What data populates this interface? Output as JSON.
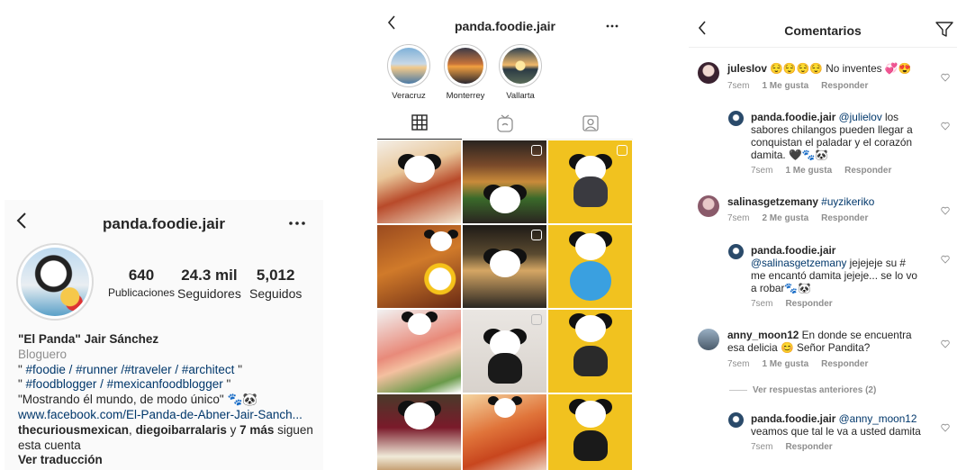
{
  "profile": {
    "back_icon": "chevron-left-icon",
    "username": "panda.foodie.jair",
    "more_icon": "more-horizontal-icon",
    "stats": [
      {
        "value": "640",
        "label": "Publicaciones"
      },
      {
        "value": "24.3 mil",
        "label": "Seguidores"
      },
      {
        "value": "5,012",
        "label": "Seguidos"
      }
    ],
    "bio": {
      "name": "\"El Panda\" Jair Sánchez",
      "category": "Bloguero",
      "line1_pre": "\" ",
      "line1_tags": "#foodie / #runner /#traveler / #architect",
      "line1_post": " \"",
      "line2_pre": "\" ",
      "line2_tags": "#foodblogger / #mexicanfoodblogger",
      "line2_post": " \"",
      "line3": "\"Mostrando él mundo, de modo único\" 🐾🐼",
      "link": "www.facebook.com/El-Panda-de-Abner-Jair-Sanch...",
      "followers_a": "thecuriousmexican",
      "followers_sep1": ", ",
      "followers_b": "diegoibarralaris",
      "followers_sep2": " y ",
      "followers_c": "7 más",
      "followers_tail": " siguen",
      "followers_tail2": "esta cuenta",
      "translate": "Ver traducción"
    }
  },
  "grid_view": {
    "username": "panda.foodie.jair",
    "highlights": [
      {
        "label": "Veracruz"
      },
      {
        "label": "Monterrey"
      },
      {
        "label": "Vallarta"
      }
    ],
    "tabs": [
      "grid-icon",
      "igtv-icon",
      "tagged-icon"
    ]
  },
  "comments": {
    "title": "Comentarios",
    "filter_icon": "filter-icon",
    "items": [
      {
        "user": "julesIov",
        "text": " 😌😌😌😌 No inventes 💞😍",
        "time": "7sem",
        "likes": "1 Me gusta",
        "reply": "Responder"
      },
      {
        "user": "panda.foodie.jair",
        "mention": "@julielov",
        "text": " los sabores chilangos pueden llegar a conquistan el paladar y el corazón damita. 🖤🐾🐼",
        "time": "7sem",
        "likes": "1 Me gusta",
        "reply": "Responder"
      },
      {
        "user": "salinasgetzemany",
        "mention": "#uyzikeriko",
        "text": "",
        "time": "7sem",
        "likes": "2 Me gusta",
        "reply": "Responder"
      },
      {
        "user": "panda.foodie.jair",
        "mention": "@salinasgetzemany",
        "text": " jejejeje su # me encantó  damita jejeje... se lo vo a robar🐾🐼",
        "time": "7sem",
        "likes": "",
        "reply": "Responder"
      },
      {
        "user": "anny_moon12",
        "text": " En donde se encuentra esa delicia 😊 Señor Pandita?",
        "time": "7sem",
        "likes": "1 Me gusta",
        "reply": "Responder"
      },
      {
        "user": "panda.foodie.jair",
        "mention": "@anny_moon12",
        "text": " veamos que tal le va a usted damita",
        "time": "7sem",
        "likes": "",
        "reply": "Responder"
      }
    ],
    "view_previous": "Ver respuestas anteriores (2)"
  }
}
